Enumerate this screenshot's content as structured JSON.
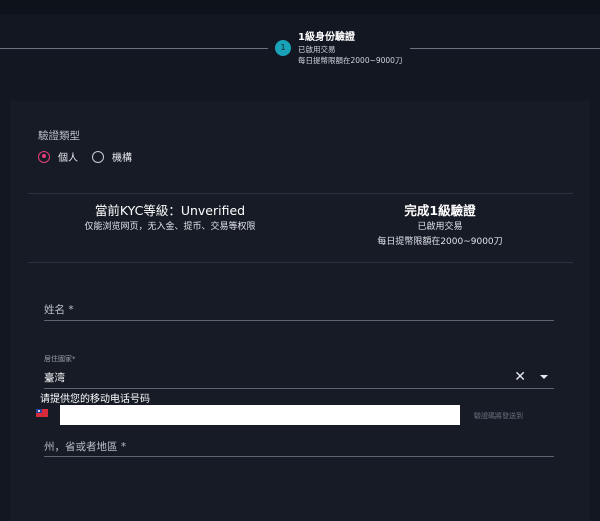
{
  "stepper": {
    "step_number": "1",
    "title": "1級身份驗證",
    "line1": "已啟用交易",
    "line2": "每日提幣限額在2000~9000刀"
  },
  "verification_type": {
    "label": "驗證類型",
    "options": [
      {
        "label": "個人",
        "selected": true
      },
      {
        "label": "機構",
        "selected": false
      }
    ]
  },
  "kyc": {
    "current_title_prefix": "當前KYC等級：",
    "current_level": "Unverified",
    "current_desc": "仅能浏览网页，无入金、提币、交易等权限",
    "next_title": "完成1級驗證",
    "next_line1": "已啟用交易",
    "next_line2": "每日提幣限額在2000~9000刀"
  },
  "form": {
    "name_label": "姓名 *",
    "country_label": "居住國家*",
    "country_value": "臺湾",
    "region_label": "州，省或者地區 *"
  },
  "phone": {
    "label": "请提供您的移动电话号码",
    "hint": "驗證碼將發送到"
  },
  "colors": {
    "accent": "#e53f79",
    "step": "#1aa2b8"
  }
}
